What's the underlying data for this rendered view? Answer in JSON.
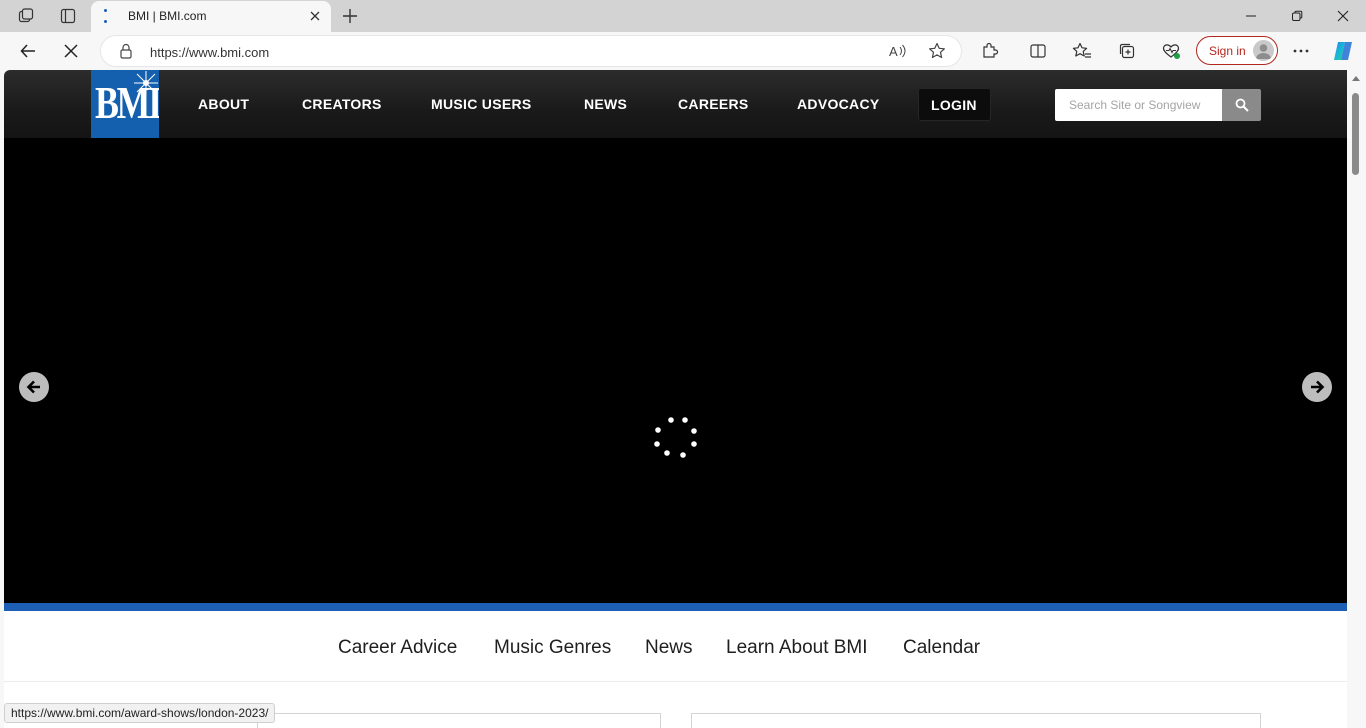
{
  "browser": {
    "tab_title": "BMI | BMI.com",
    "url": "https://www.bmi.com",
    "sign_in_label": "Sign in",
    "status_url": "https://www.bmi.com/award-shows/london-2023/"
  },
  "site": {
    "logo_text": "BMI",
    "nav": [
      "ABOUT",
      "CREATORS",
      "MUSIC USERS",
      "NEWS",
      "CAREERS",
      "ADVOCACY"
    ],
    "login_label": "LOGIN",
    "search_placeholder": "Search Site or Songview"
  },
  "subnav": [
    "Career Advice",
    "Music Genres",
    "News",
    "Learn About BMI",
    "Calendar"
  ],
  "colors": {
    "brand_blue": "#1460ae",
    "hero_bar": "#1d5fb4",
    "header_dark": "#1a1a1a",
    "signin_red": "#b3261e"
  },
  "icons": [
    "workspaces-icon",
    "tab-actions-icon",
    "close-icon",
    "plus-icon",
    "minimize-icon",
    "restore-icon",
    "back-icon",
    "stop-icon",
    "lock-icon",
    "read-aloud-icon",
    "star-icon",
    "extensions-icon",
    "split-screen-icon",
    "favorites-icon",
    "collections-icon",
    "performance-icon",
    "more-icon",
    "copilot-icon",
    "search-icon",
    "arrow-left-icon",
    "arrow-right-icon",
    "loading-spinner-icon"
  ]
}
